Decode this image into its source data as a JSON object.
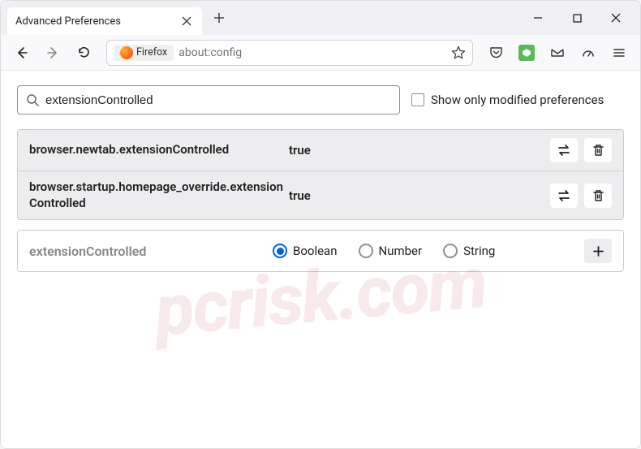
{
  "tab": {
    "title": "Advanced Preferences"
  },
  "addressbar": {
    "brand": "Firefox",
    "url": "about:config"
  },
  "search": {
    "value": "extensionControlled",
    "checkbox_label": "Show only modified preferences"
  },
  "prefs": [
    {
      "name": "browser.newtab.extensionControlled",
      "value": "true"
    },
    {
      "name": "browser.startup.homepage_override.extensionControlled",
      "value": "true"
    }
  ],
  "new_pref": {
    "name": "extensionControlled",
    "types": [
      {
        "label": "Boolean",
        "selected": true
      },
      {
        "label": "Number",
        "selected": false
      },
      {
        "label": "String",
        "selected": false
      }
    ]
  },
  "watermark": "pcrisk.com"
}
